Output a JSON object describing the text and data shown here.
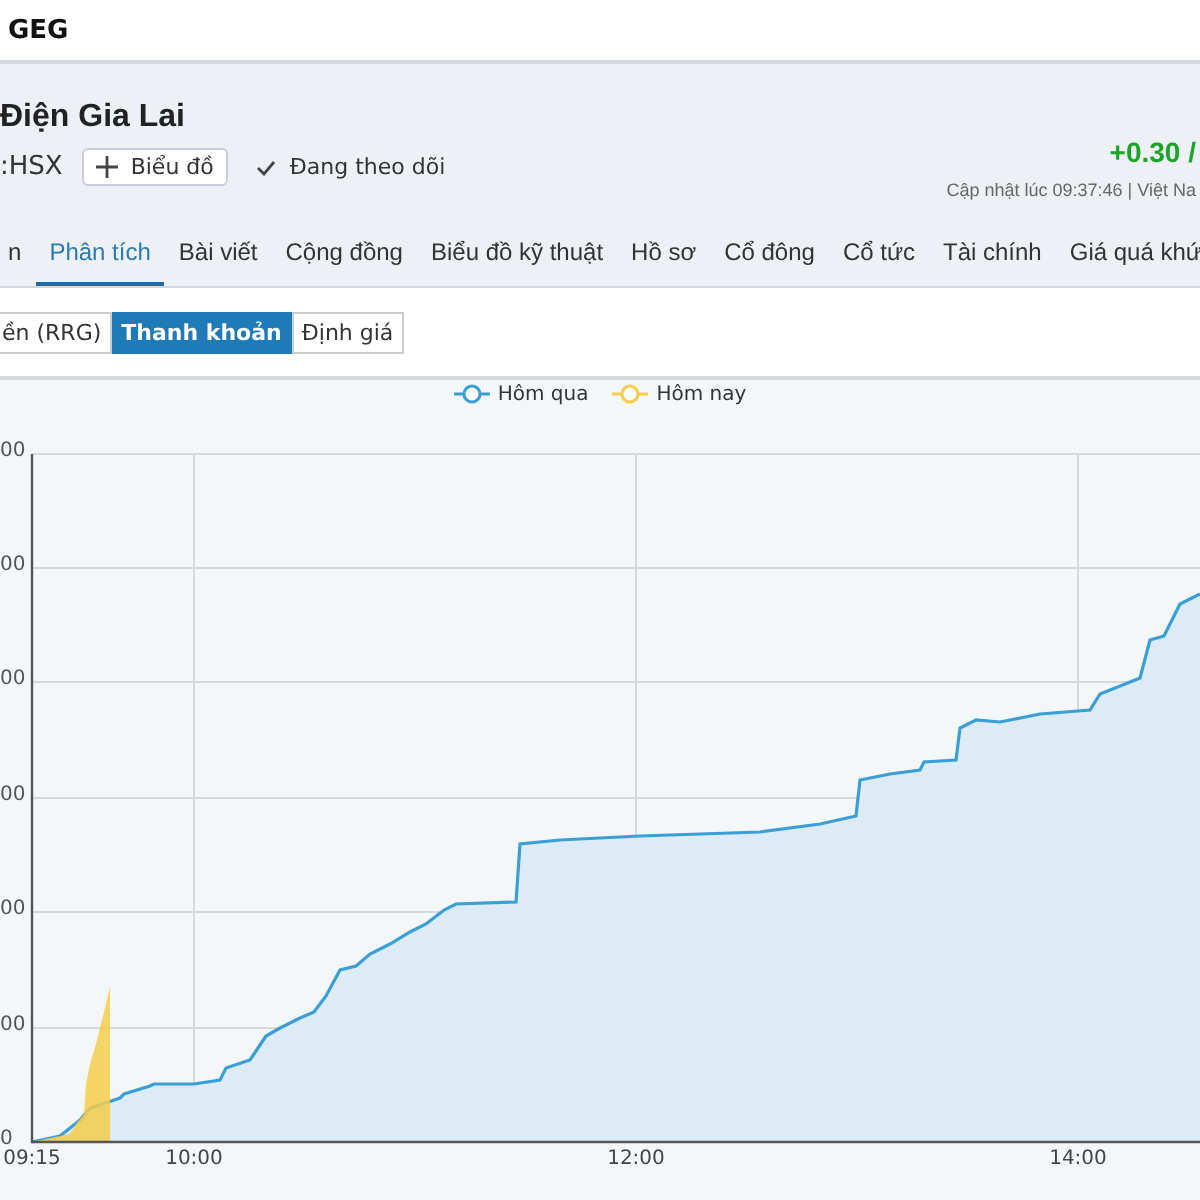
{
  "header": {
    "ticker": "GEG"
  },
  "company": {
    "name": "Điện Gia Lai",
    "exchange": ":HSX",
    "chart_button": "Biểu đồ",
    "follow_label": "Đang theo dõi",
    "change": "+0.30 /",
    "updated": "Cập nhật lúc  09:37:46 | Việt Na"
  },
  "tabs": [
    {
      "label": "n",
      "selected": false
    },
    {
      "label": "Phân tích",
      "selected": true
    },
    {
      "label": "Bài viết",
      "selected": false
    },
    {
      "label": "Cộng đồng",
      "selected": false
    },
    {
      "label": "Biểu đồ kỹ thuật",
      "selected": false
    },
    {
      "label": "Hồ sơ",
      "selected": false
    },
    {
      "label": "Cổ đông",
      "selected": false
    },
    {
      "label": "Cổ tức",
      "selected": false
    },
    {
      "label": "Tài chính",
      "selected": false
    },
    {
      "label": "Giá quá khứ",
      "selected": false
    }
  ],
  "sub_tabs": [
    {
      "label": "ền (RRG)",
      "selected": false
    },
    {
      "label": "Thanh khoản",
      "selected": true
    },
    {
      "label": "Định giá",
      "selected": false
    }
  ],
  "chart": {
    "legend": [
      {
        "label": "Hôm qua",
        "color": "#3a9fd6"
      },
      {
        "label": "Hôm nay",
        "color": "#f5cd4a"
      }
    ],
    "y_tick_labels": [
      "00",
      "00",
      "00",
      "00",
      "00",
      "00",
      "0"
    ],
    "x_tick_labels": [
      "09:15",
      "10:00",
      "12:00",
      "14:00"
    ]
  }
}
